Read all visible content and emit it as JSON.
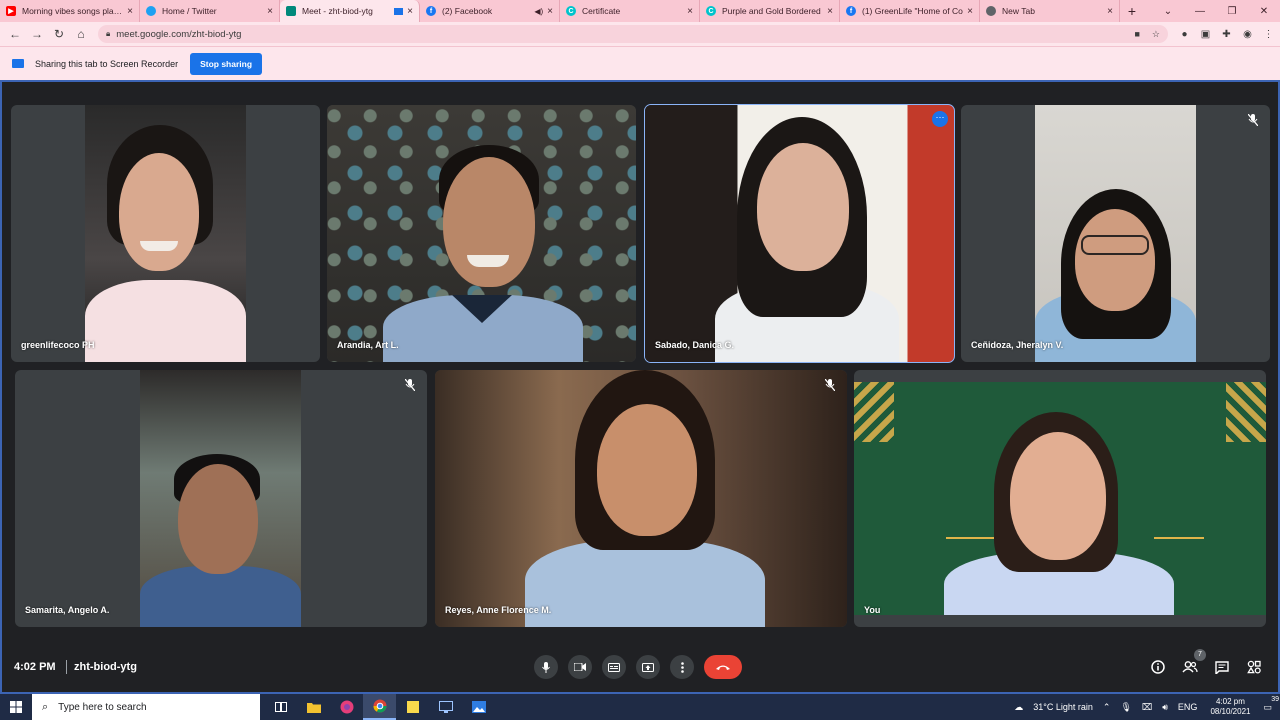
{
  "browser": {
    "tabs": [
      {
        "title": "Morning vibes songs playlist",
        "icon_color": "#ff0000",
        "icon": "youtube-icon"
      },
      {
        "title": "Home / Twitter",
        "icon_color": "#1da1f2",
        "icon": "twitter-icon"
      },
      {
        "title": "Meet - zht-biod-ytg",
        "icon_color": "#00897b",
        "icon": "meet-icon",
        "active": true
      },
      {
        "title": "(2) Facebook",
        "icon_color": "#1877f2",
        "icon": "facebook-icon"
      },
      {
        "title": "Certificate",
        "icon_color": "#00c4cc",
        "icon": "canva-icon"
      },
      {
        "title": "Purple and Gold Bordered",
        "icon_color": "#00c4cc",
        "icon": "canva-icon"
      },
      {
        "title": "(1) GreenLife \"Home of Co",
        "icon_color": "#1877f2",
        "icon": "facebook-icon"
      },
      {
        "title": "New Tab",
        "icon_color": "#5f6368",
        "icon": "chrome-icon"
      }
    ],
    "url": "meet.google.com/zht-biod-ytg"
  },
  "share_bar": {
    "text": "Sharing this tab to Screen Recorder",
    "stop_label": "Stop sharing"
  },
  "meet": {
    "participants": [
      {
        "name": "greenlifecoco PH",
        "muted": false
      },
      {
        "name": "Arandia, Art L.",
        "muted": false
      },
      {
        "name": "Sabado, Danica G.",
        "muted": false,
        "pinned": true
      },
      {
        "name": "Ceñidoza, Jheralyn V.",
        "muted": true
      },
      {
        "name": "Samarita, Angelo A.",
        "muted": true
      },
      {
        "name": "Reyes, Anne Florence M.",
        "muted": true
      },
      {
        "name": "You",
        "muted": false
      }
    ],
    "time": "4:02 PM",
    "meeting_code": "zht-biod-ytg",
    "people_count": "7"
  },
  "taskbar": {
    "search_placeholder": "Type here to search",
    "weather": "31°C  Light rain",
    "language": "ENG",
    "time": "4:02 pm",
    "date": "08/10/2021",
    "notifications": "39"
  }
}
